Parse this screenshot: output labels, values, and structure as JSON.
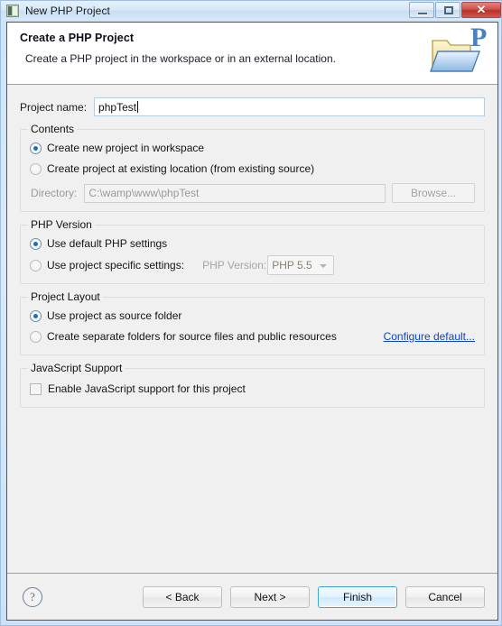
{
  "window": {
    "title": "New PHP Project",
    "icon": "php-project-icon",
    "controls": {
      "minimize": "minimize-button",
      "maximize": "maximize-button",
      "close_glyph": "✕"
    }
  },
  "header": {
    "title": "Create a PHP Project",
    "subtitle": "Create a PHP project in the workspace or in an external location.",
    "icon": "php-folder-icon"
  },
  "project_name": {
    "label": "Project name:",
    "value": "phpTest",
    "placeholder": ""
  },
  "contents": {
    "legend": "Contents",
    "options": [
      {
        "label": "Create new project in workspace",
        "checked": true,
        "enabled": true
      },
      {
        "label": "Create project at existing location (from existing source)",
        "checked": false,
        "enabled": true
      }
    ],
    "directory": {
      "label": "Directory:",
      "value": "C:\\wamp\\www\\phpTest",
      "enabled": false
    },
    "browse_label": "Browse..."
  },
  "php_version": {
    "legend": "PHP Version",
    "options": [
      {
        "label": "Use default PHP settings",
        "checked": true,
        "enabled": true
      },
      {
        "label": "Use project specific settings:",
        "checked": false,
        "enabled": true
      }
    ],
    "combo_label": "PHP Version:",
    "combo_value": "PHP 5.5",
    "combo_enabled": false
  },
  "project_layout": {
    "legend": "Project Layout",
    "options": [
      {
        "label": "Use project as source folder",
        "checked": true,
        "enabled": true
      },
      {
        "label": "Create separate folders for source files and public resources",
        "checked": false,
        "enabled": true
      }
    ],
    "configure_link": "Configure default..."
  },
  "javascript_support": {
    "legend": "JavaScript Support",
    "checkbox": {
      "label": "Enable JavaScript support for this project",
      "checked": false
    }
  },
  "footer": {
    "help": "?",
    "buttons": [
      {
        "label": "< Back",
        "default": false
      },
      {
        "label": "Next >",
        "default": false
      },
      {
        "label": "Finish",
        "default": true
      },
      {
        "label": "Cancel",
        "default": false
      }
    ]
  },
  "colors": {
    "accent": "#1c6fc0",
    "link": "#0a46c8",
    "dialog_bg": "#f0f0f0",
    "close_button": "#b93028"
  }
}
